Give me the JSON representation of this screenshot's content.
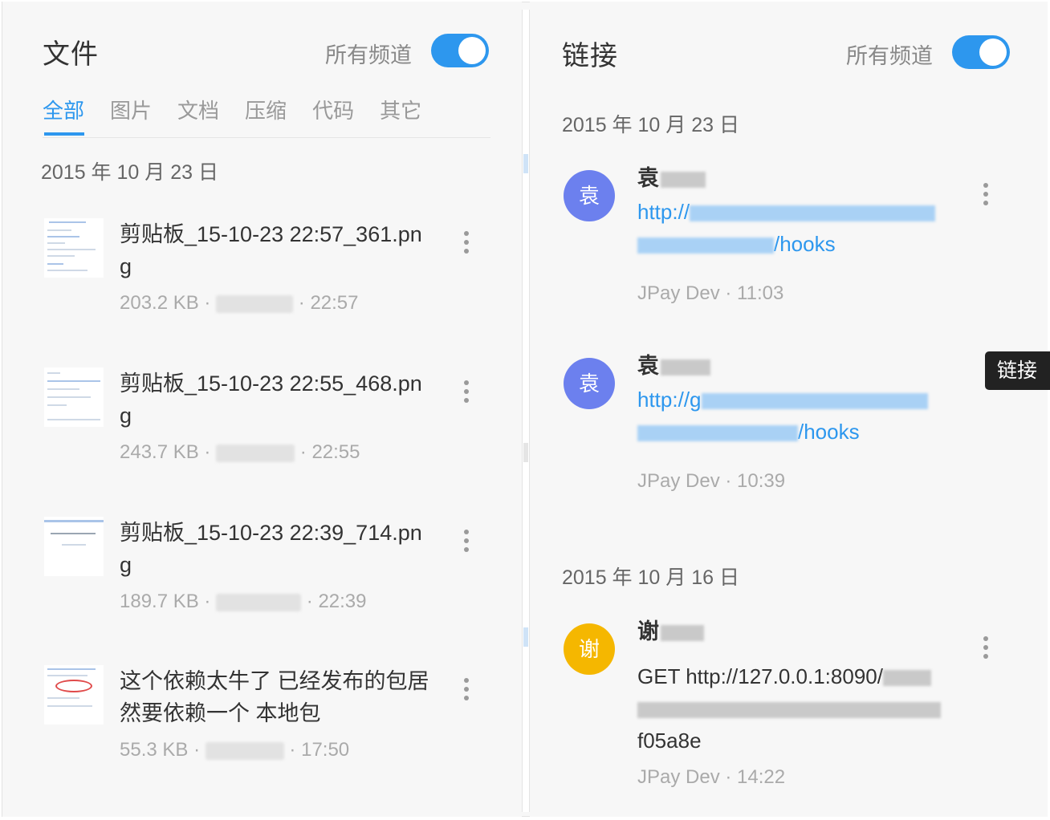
{
  "files_panel": {
    "title": "文件",
    "channel_label": "所有频道",
    "toggle_on": true,
    "tabs": [
      "全部",
      "图片",
      "文档",
      "压缩",
      "代码",
      "其它"
    ],
    "active_tab": "全部",
    "date": "2015 年 10 月 23 日",
    "items": [
      {
        "name": "剪贴板_15-10-23 22:57_361.png",
        "size": "203.2 KB",
        "time": "22:57"
      },
      {
        "name": "剪贴板_15-10-23 22:55_468.png",
        "size": "243.7 KB",
        "time": "22:55"
      },
      {
        "name": "剪贴板_15-10-23 22:39_714.png",
        "size": "189.7 KB",
        "time": "22:39"
      },
      {
        "name": "这个依赖太牛了 已经发布的包居然要依赖一个 本地包",
        "size": "55.3 KB",
        "time": "17:50"
      }
    ]
  },
  "links_panel": {
    "title": "链接",
    "channel_label": "所有频道",
    "toggle_on": true,
    "groups": [
      {
        "date": "2015 年 10 月 23 日",
        "items": [
          {
            "avatar": "袁",
            "avatar_color": "#6c80ee",
            "name": "袁",
            "url_start": "http://",
            "url_end": "/hooks",
            "channel": "JPay Dev",
            "time": "11:03"
          },
          {
            "avatar": "袁",
            "avatar_color": "#6c80ee",
            "name": "袁",
            "url_start": "http://g",
            "url_end": "/hooks",
            "channel": "JPay Dev",
            "time": "10:39"
          }
        ]
      },
      {
        "date": "2015 年 10 月 16 日",
        "items": [
          {
            "avatar": "谢",
            "avatar_color": "#f5b700",
            "name": "谢",
            "url_start": "GET http://127.0.0.1:8090/",
            "url_end": "f05a8e",
            "channel": "JPay Dev",
            "time": "14:22"
          }
        ]
      }
    ]
  },
  "tooltip": "链接",
  "meta_separator": "·",
  "colors": {
    "accent": "#2d97ee",
    "avatar_purple": "#6c80ee",
    "avatar_yellow": "#f5b700"
  }
}
